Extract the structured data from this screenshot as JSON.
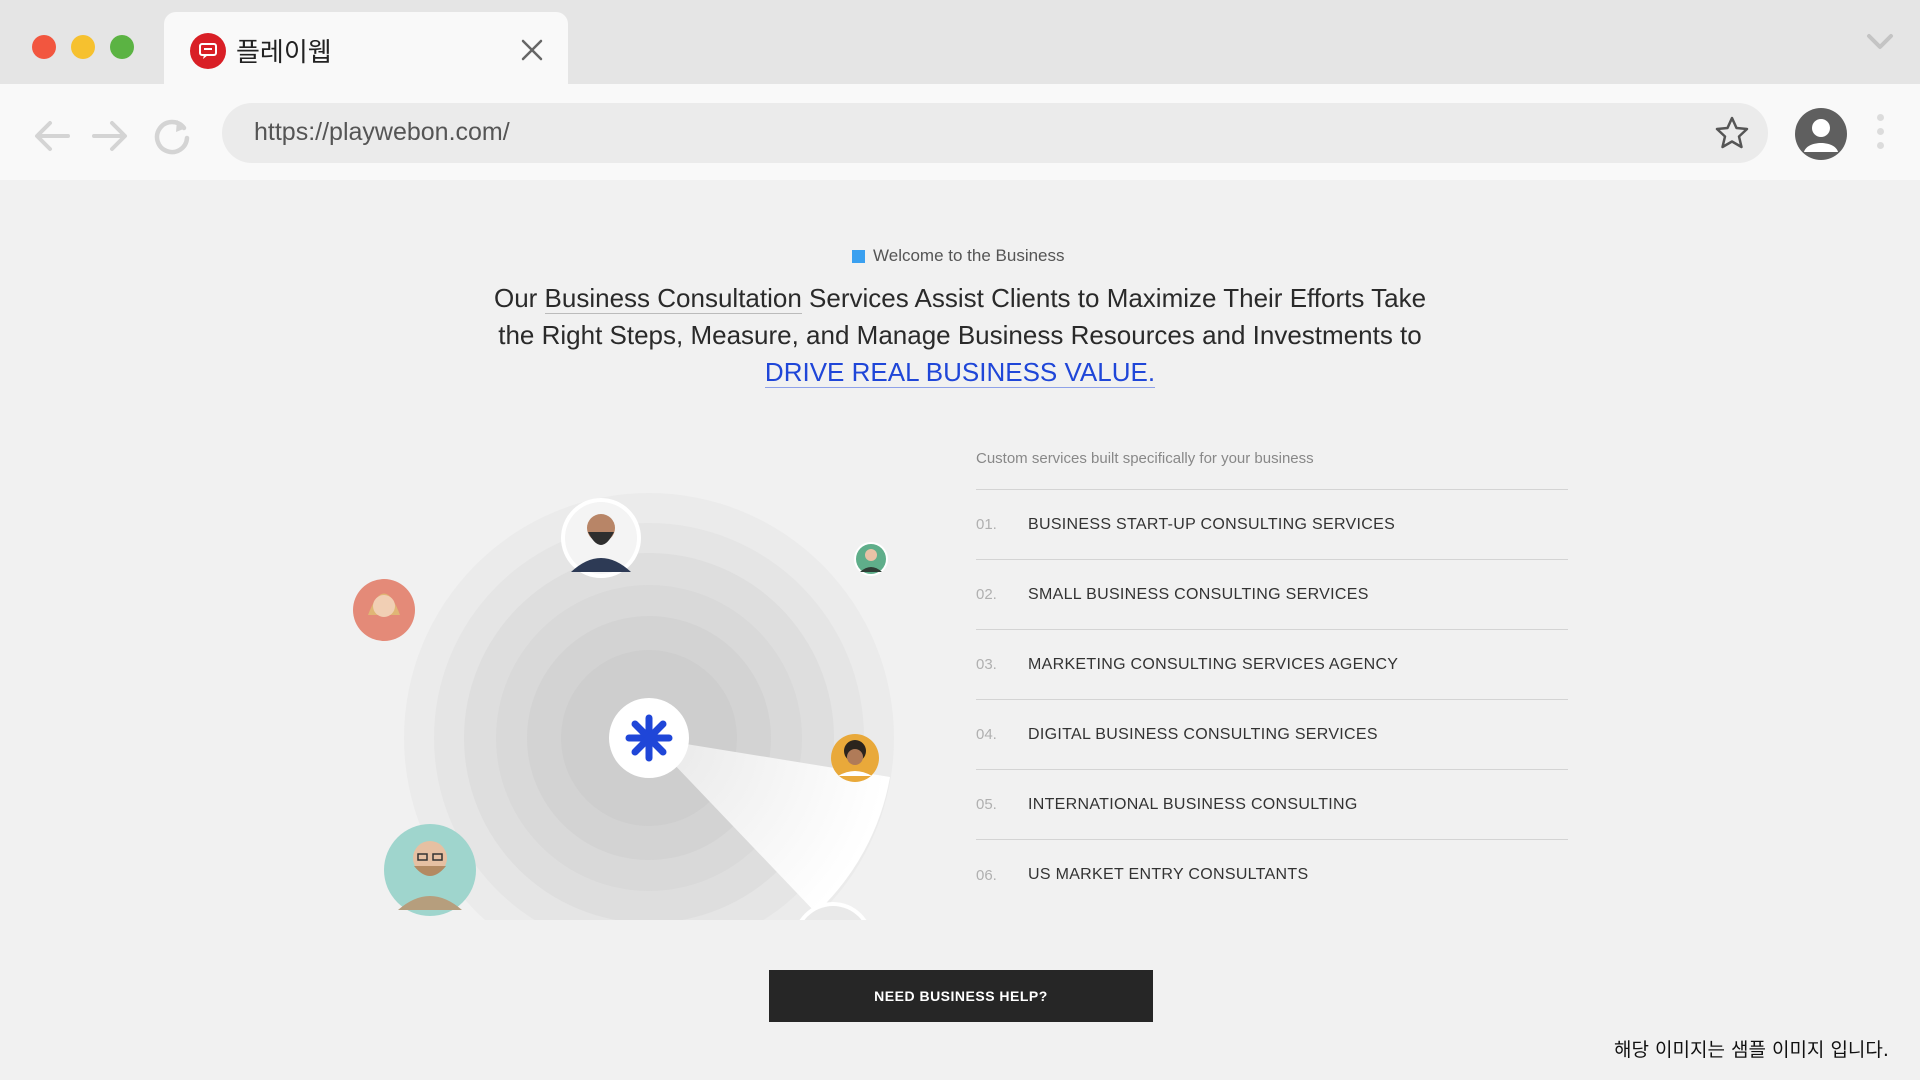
{
  "browser": {
    "tab_title": "플레이웹",
    "url": "https://playwebon.com/"
  },
  "hero": {
    "eyebrow": "Welcome to the Business",
    "headline_part1": "Our ",
    "headline_link": "Business Consultation",
    "headline_part2": " Services Assist Clients to Maximize Their Efforts Take the Right Steps, Measure, and Manage Business Resources and Investments to ",
    "headline_highlight": "DRIVE REAL BUSINESS VALUE."
  },
  "services": {
    "caption": "Custom services built specifically for your business",
    "items": [
      {
        "num": "01.",
        "label": "BUSINESS START-UP CONSULTING SERVICES"
      },
      {
        "num": "02.",
        "label": "SMALL BUSINESS CONSULTING SERVICES"
      },
      {
        "num": "03.",
        "label": "MARKETING CONSULTING SERVICES AGENCY"
      },
      {
        "num": "04.",
        "label": "DIGITAL BUSINESS CONSULTING SERVICES"
      },
      {
        "num": "05.",
        "label": "INTERNATIONAL BUSINESS CONSULTING"
      },
      {
        "num": "06.",
        "label": "US MARKET ENTRY CONSULTANTS"
      }
    ]
  },
  "cta": {
    "label": "NEED BUSINESS HELP?"
  },
  "notice": "해당 이미지는 샘플 이미지 입니다.",
  "colors": {
    "accent_blue": "#1f46d8",
    "eyebrow_square": "#3aa0f0",
    "favicon_red": "#d91f26",
    "cta_bg": "#262626"
  }
}
